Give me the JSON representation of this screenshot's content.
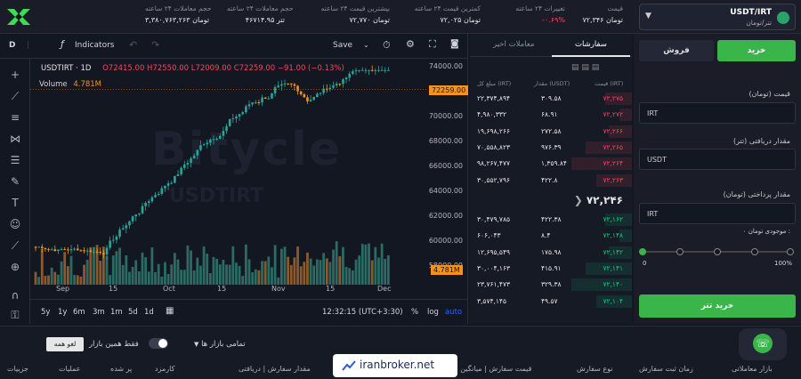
{
  "pair": {
    "name": "USDT/IRT",
    "sub": "تتر/تومان"
  },
  "stats": [
    {
      "label": "قیمت",
      "value": "۷۲,۳۴۶ تومان",
      "color": "#e6e6e6"
    },
    {
      "label": "تغییرات ۲۴ ساعته",
      "value": "-۰.۶۹%",
      "color": "#f6465d"
    },
    {
      "label": "کمترین قیمت ۲۴ ساعته",
      "value": "۷۲,۰۲۵ تومان",
      "color": "#e6e6e6"
    },
    {
      "label": "بیشترین قیمت ۲۴ ساعته",
      "value": "۷۲,۷۷۰ تومان",
      "color": "#e6e6e6"
    },
    {
      "label": "حجم معاملات ۲۴ ساعته",
      "value": "۴۶۷۱۴.۹۵ تتر",
      "color": "#e6e6e6"
    },
    {
      "label": "حجم معاملات ۲۴ ساعته",
      "value": "۳,۳۸۰,۷۶۳,۲۶۳ تومان",
      "color": "#e6e6e6"
    }
  ],
  "tv": {
    "interval": "D",
    "indicators": "Indicators",
    "save": "Save",
    "symbol": "USDTIRT · 1D",
    "ohlc": "O72415.00 H72550.00 L72009.00 C72259.00 −91.00 (−0.13%)",
    "volume_label": "Volume",
    "volume_value": "4.781M",
    "price_tag": "72259.00",
    "vol_tag": "4.781M",
    "watermark": "Bitycle",
    "watermark2": "USDTIRT",
    "yticks": [
      "74000.00",
      "72000.00",
      "70000.00",
      "68000.00",
      "66000.00",
      "64000.00",
      "62000.00",
      "60000.00",
      "58000.00"
    ],
    "xticks": [
      "Sep",
      "15",
      "Oct",
      "15",
      "Nov",
      "15",
      "Dec"
    ],
    "ranges": [
      "5y",
      "1y",
      "6m",
      "3m",
      "1m",
      "5d",
      "1d"
    ],
    "time": "12:32:15 (UTC+3:30)",
    "pct": "%",
    "log": "log",
    "auto": "auto"
  },
  "book": {
    "tab_orders": "سفارشات",
    "tab_trades": "معاملات اخیر",
    "headers": [
      "مبلغ کل (IRT)",
      "مقدار (USDT)",
      "قیمت (IRT)"
    ],
    "asks": [
      [
        "۲۲,۳۷۴,۸۹۴",
        "۳۰۹.۵۸",
        "۷۲,۲۷۵"
      ],
      [
        "۴,۹۸۰,۳۳۲",
        "۶۸.۹۱",
        "۷۲,۲۷۲"
      ],
      [
        "۱۹,۶۹۸,۲۶۶",
        "۲۷۲.۵۸",
        "۷۲,۲۶۶"
      ],
      [
        "۷۰,۵۵۸,۸۲۳",
        "۹۷۶.۳۹",
        "۷۲,۲۶۵"
      ],
      [
        "۹۸,۲۶۷,۴۷۷",
        "۱,۳۵۹.۸۴",
        "۷۲,۲۶۴"
      ],
      [
        "۳۰,۵۵۲,۷۹۶",
        "۴۲۲.۸",
        "۷۲,۲۶۳"
      ]
    ],
    "mid": "۷۲,۲۴۶",
    "bids": [
      [
        "۳۰,۴۷۹,۷۸۵",
        "۴۲۲.۳۸",
        "۷۲,۱۶۲"
      ],
      [
        "۶۰۶,۰۴۳",
        "۸.۴",
        "۷۲,۱۴۸"
      ],
      [
        "۱۲,۶۹۵,۵۴۹",
        "۱۷۵.۹۸",
        "۷۲,۱۴۲"
      ],
      [
        "۳۰,۰۰۴,۱۶۳",
        "۴۱۵.۹۱",
        "۷۲,۱۴۱"
      ],
      [
        "۲۳,۷۶۱,۴۷۳",
        "۳۲۹.۳۸",
        "۷۲,۱۴۰"
      ],
      [
        "۳,۵۷۴,۱۴۵",
        "۴۹.۵۷",
        "۷۲,۱۰۴"
      ]
    ]
  },
  "form": {
    "buy": "خرید",
    "sell": "فروش",
    "price_label": "قیمت (تومان)",
    "price_unit": "IRT",
    "recv_label": "مقدار دریافتی (تتر)",
    "recv_unit": "USDT",
    "pay_label": "مقدار پرداختی (تومان)",
    "pay_unit": "IRT",
    "balance_label": "موجودی تومان :",
    "balance_value": "۰",
    "slider_min": "0",
    "slider_max": "100%",
    "submit": "خرید تتر"
  },
  "bottom": {
    "cancel_all": "لغو همه",
    "only_market": "فقط همین بازار",
    "market_type": "تمامی بازار ها",
    "headers": [
      "بازار معاملاتی",
      "زمان ثبت سفارش",
      "نوع سفارش",
      "قیمت سفارش | میانگین قیمت",
      "مقدار سفارش | دریافتی",
      "کارمزد",
      "پر شده",
      "عملیات",
      "جزییات"
    ],
    "brand": "iranbroker.net"
  }
}
